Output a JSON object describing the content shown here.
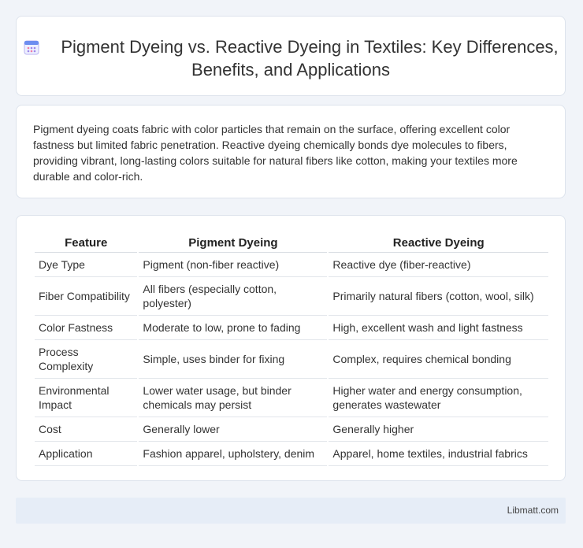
{
  "header": {
    "icon": "calendar-icon",
    "title": "Pigment Dyeing vs. Reactive Dyeing in Textiles: Key Differences, Benefits, and Applications"
  },
  "intro": {
    "text": "Pigment dyeing coats fabric with color particles that remain on the surface, offering excellent color fastness but limited fabric penetration. Reactive dyeing chemically bonds dye molecules to fibers, providing vibrant, long-lasting colors suitable for natural fibers like cotton, making your textiles more durable and color-rich."
  },
  "table": {
    "headers": [
      "Feature",
      "Pigment Dyeing",
      "Reactive Dyeing"
    ],
    "rows": [
      [
        "Dye Type",
        "Pigment (non-fiber reactive)",
        "Reactive dye (fiber-reactive)"
      ],
      [
        "Fiber Compatibility",
        "All fibers (especially cotton, polyester)",
        "Primarily natural fibers (cotton, wool, silk)"
      ],
      [
        "Color Fastness",
        "Moderate to low, prone to fading",
        "High, excellent wash and light fastness"
      ],
      [
        "Process Complexity",
        "Simple, uses binder for fixing",
        "Complex, requires chemical bonding"
      ],
      [
        "Environmental Impact",
        "Lower water usage, but binder chemicals may persist",
        "Higher water and energy consumption, generates wastewater"
      ],
      [
        "Cost",
        "Generally lower",
        "Generally higher"
      ],
      [
        "Application",
        "Fashion apparel, upholstery, denim",
        "Apparel, home textiles, industrial fabrics"
      ]
    ]
  },
  "footer": {
    "brand": "Libmatt.com"
  }
}
